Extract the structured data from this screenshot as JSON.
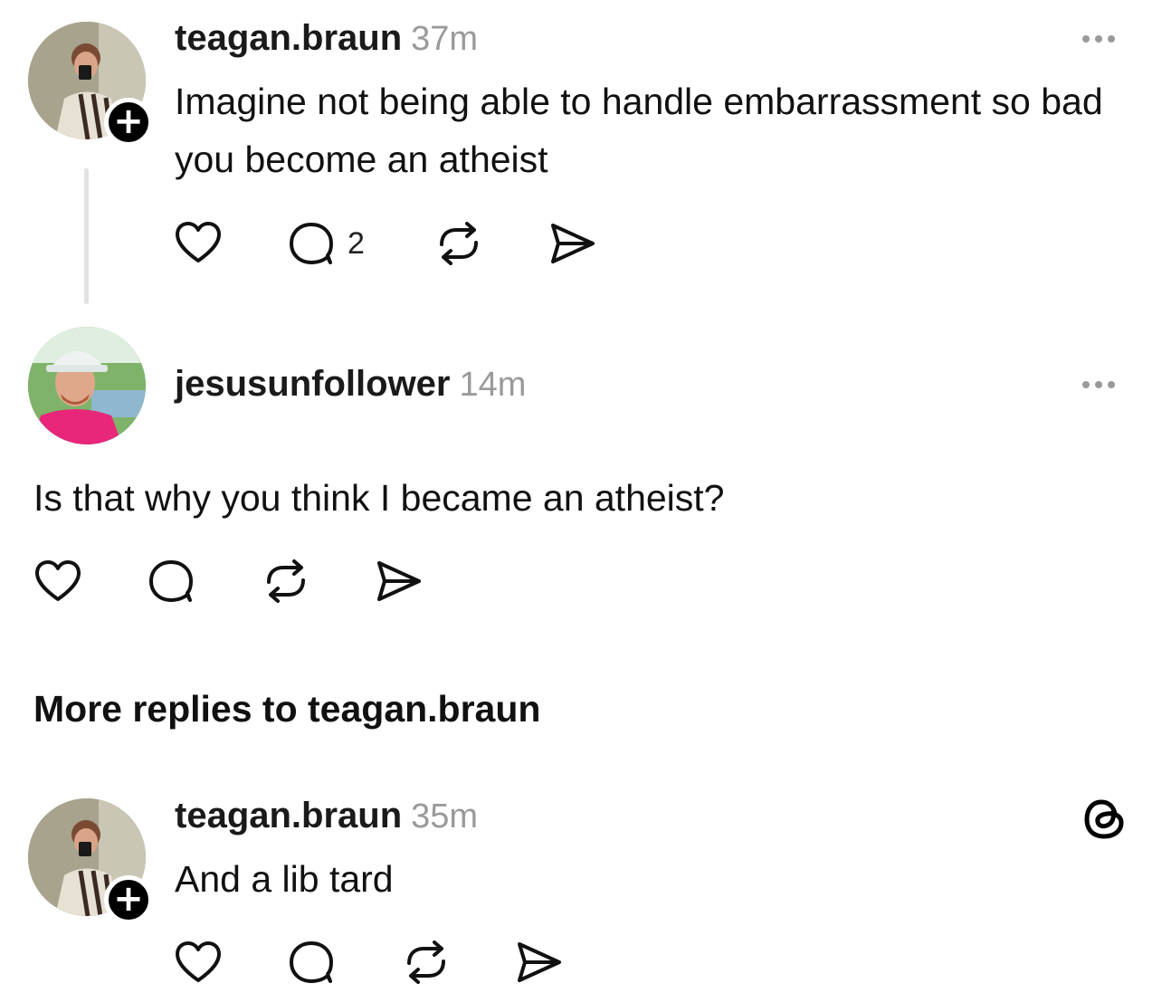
{
  "posts": [
    {
      "username": "teagan.braun",
      "time": "37m",
      "text": "Imagine not being able to handle embarrassment so bad you become an atheist",
      "reply_count": "2"
    },
    {
      "username": "jesusunfollower",
      "time": "14m",
      "text": "Is that why you think I became an atheist?"
    }
  ],
  "section": {
    "title": "More replies to teagan.braun"
  },
  "reply": {
    "username": "teagan.braun",
    "time": "35m",
    "text": "And a lib tard"
  },
  "icons": {
    "like": "heart-icon",
    "comment": "comment-icon",
    "repost": "repost-icon",
    "share": "send-icon",
    "more": "more-dots-icon",
    "follow": "plus-icon",
    "brand": "threads-logo-icon"
  }
}
